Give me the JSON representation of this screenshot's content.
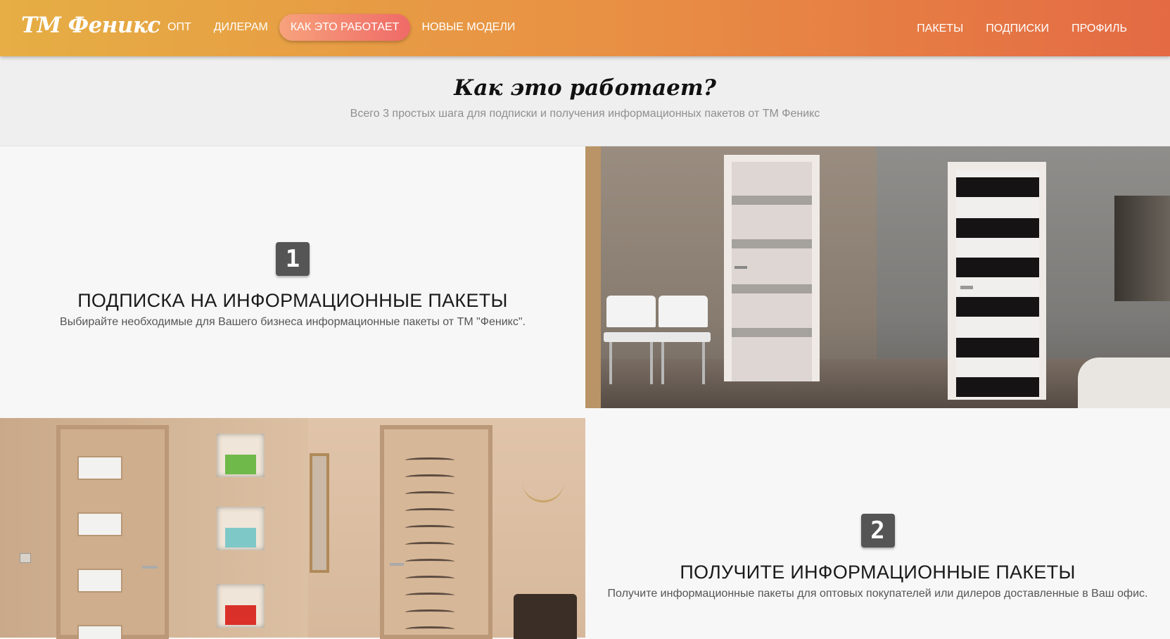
{
  "brand": "ТМ Феникс",
  "nav": {
    "left": [
      "ОПТ",
      "ДИЛЕРАМ",
      "КАК ЭТО РАБОТАЕТ",
      "НОВЫЕ МОДЕЛИ"
    ],
    "right": [
      "ПАКЕТЫ",
      "ПОДПИСКИ",
      "ПРОФИЛЬ"
    ],
    "active": "КАК ЭТО РАБОТАЕТ"
  },
  "hero": {
    "title": "Как это работает?",
    "subtitle": "Всего 3 простых шага для подписки и получения информационных пакетов от ТМ Феникс"
  },
  "steps": [
    {
      "number": "1",
      "title": "ПОДПИСКА НА ИНФОРМАЦИОННЫЕ ПАКЕТЫ",
      "description": "Выбирайте необходимые для Вашего бизнеса информационные пакеты от ТМ \"Феникс\"."
    },
    {
      "number": "2",
      "title": "ПОЛУЧИТЕ ИНФОРМАЦИОННЫЕ ПАКЕТЫ",
      "description": "Получите информационные пакеты для оптовых покупателей или дилеров доставленные в Ваш офис."
    }
  ],
  "colors": {
    "nav_gradient_start": "#e6ae44",
    "nav_gradient_end": "#e46a44",
    "active_pill": "#ef6a67",
    "badge": "#555555"
  }
}
